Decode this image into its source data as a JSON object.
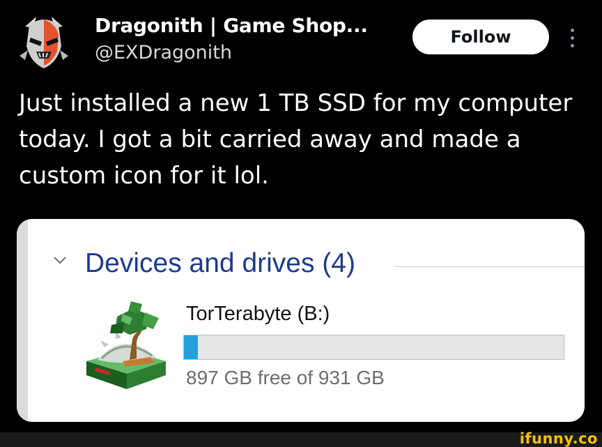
{
  "author": {
    "display_name": "Dragonith | Game Shop...",
    "handle": "@EXDragonith"
  },
  "actions": {
    "follow_label": "Follow",
    "more_icon": "more-vertical-icon"
  },
  "tweet": {
    "text": "Just installed a new 1 TB SSD for my computer today. I got a bit carried away and made a custom icon for it lol."
  },
  "media": {
    "section_title": "Devices and drives (4)",
    "drive": {
      "name": "TorTerabyte (B:)",
      "free_text": "897 GB free of 931 GB",
      "used_fraction": 0.037,
      "bar_color": "#26a0da",
      "icon": "tortoise-drive-icon"
    }
  },
  "watermark": {
    "text": "ifunny.co",
    "color": "#f4c400"
  },
  "colors": {
    "background": "#000000",
    "follow_bg": "#ffffff",
    "section_title": "#1e3a8a"
  }
}
